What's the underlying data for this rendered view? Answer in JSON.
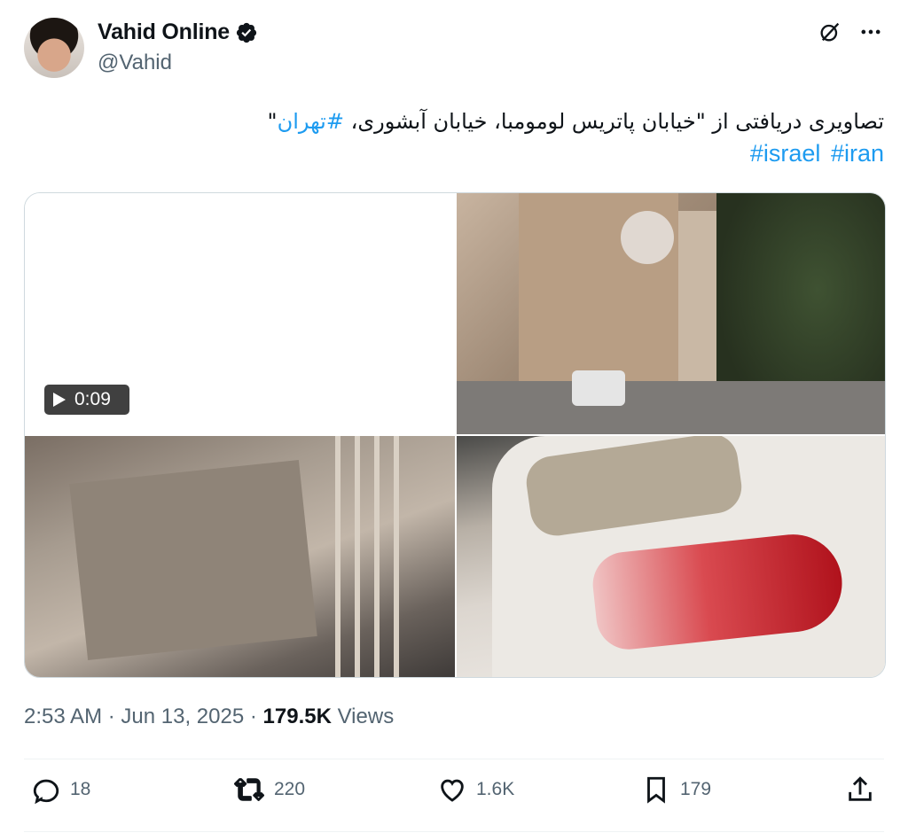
{
  "author": {
    "name": "Vahid Online",
    "handle": "@Vahid",
    "verified": true
  },
  "header_icons": [
    "grok-icon",
    "more-icon"
  ],
  "tweet": {
    "text_main": "تصاویری دریافتی از \"خیابان پاتریس لومومبا، خیابان آبشوری، ",
    "hashtag_tehran": "#تهران",
    "text_end": "\"",
    "hashtags": [
      "#israel",
      "#iran"
    ]
  },
  "media": {
    "video_duration": "0:09",
    "count": 4
  },
  "meta": {
    "time": "2:53 AM",
    "date": "Jun 13, 2025",
    "separator": "·",
    "views_count": "179.5K",
    "views_label": "Views"
  },
  "actions": {
    "replies": "18",
    "reposts": "220",
    "likes": "1.6K",
    "bookmarks": "179"
  },
  "colors": {
    "accent": "#1d9bf0",
    "muted": "#536471",
    "text": "#0f1419"
  }
}
